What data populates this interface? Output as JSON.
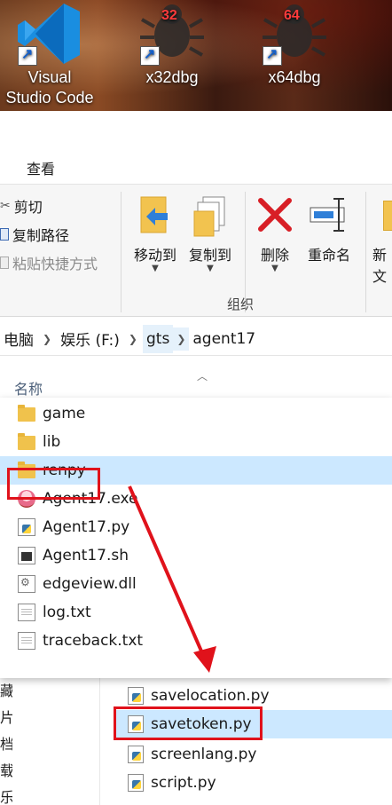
{
  "desktop": {
    "icons": [
      {
        "label_line1": "Visual",
        "label_line2": "Studio Code",
        "icon": "vscode-icon"
      },
      {
        "label_line1": "x32dbg",
        "label_line2": "",
        "badge": "32",
        "icon": "bug-icon"
      },
      {
        "label_line1": "x64dbg",
        "label_line2": "",
        "badge": "64",
        "icon": "bug-icon"
      }
    ]
  },
  "ribbon": {
    "tab_view": "查看",
    "clipboard": {
      "cut": "剪切",
      "copy_path": "复制路径",
      "paste_shortcut": "粘贴快捷方式"
    },
    "organize": {
      "move_to": "移动到",
      "copy_to": "复制到",
      "delete": "删除",
      "rename": "重命名",
      "new_folder_partial": "新",
      "new_folder_partial2": "文",
      "group_label": "组织"
    }
  },
  "address": {
    "crumbs": [
      "电脑",
      "娱乐 (F:)",
      "gts",
      "agent17"
    ]
  },
  "list_header": {
    "name_col": "名称"
  },
  "overlay_files": [
    {
      "name": "game",
      "type": "folder"
    },
    {
      "name": "lib",
      "type": "folder"
    },
    {
      "name": "renpy",
      "type": "folder",
      "selected": true
    },
    {
      "name": "Agent17.exe",
      "type": "exe"
    },
    {
      "name": "Agent17.py",
      "type": "py"
    },
    {
      "name": "Agent17.sh",
      "type": "sh"
    },
    {
      "name": "edgeview.dll",
      "type": "dll"
    },
    {
      "name": "log.txt",
      "type": "txt"
    },
    {
      "name": "traceback.txt",
      "type": "txt"
    }
  ],
  "lower_files": [
    {
      "name": "savelocation.py",
      "type": "py"
    },
    {
      "name": "savetoken.py",
      "type": "py",
      "selected": true
    },
    {
      "name": "screenlang.py",
      "type": "py"
    },
    {
      "name": "script.py",
      "type": "py"
    }
  ],
  "left_strip_chars": [
    "藏",
    "片",
    "档",
    "载",
    "乐"
  ],
  "colors": {
    "selection": "#cce8ff",
    "annotation_red": "#e0121b",
    "accent_blue": "#1560c9"
  }
}
